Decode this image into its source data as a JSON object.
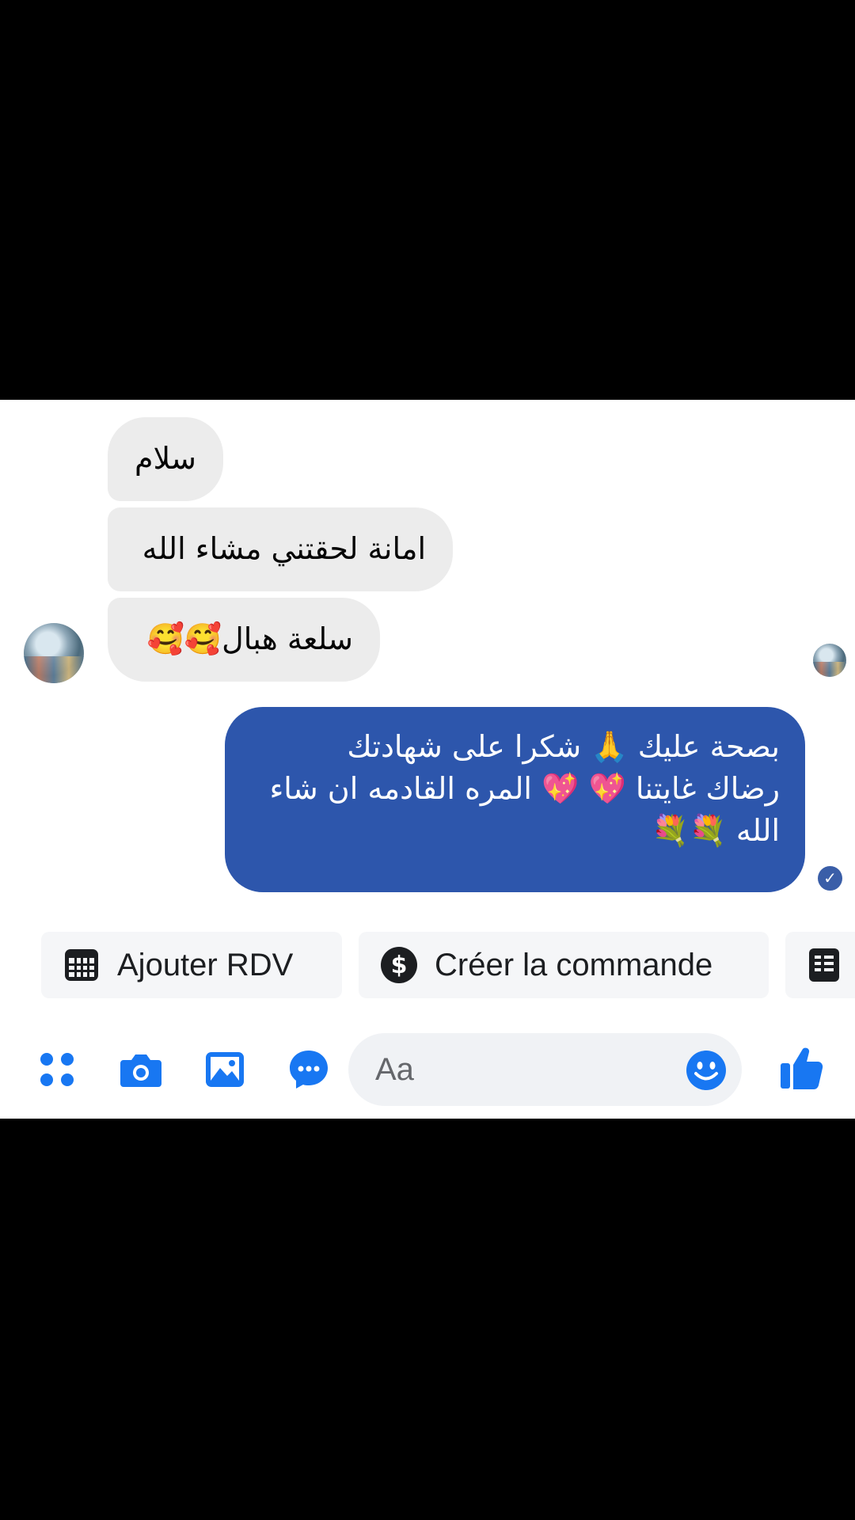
{
  "messages": {
    "incoming": [
      {
        "text": "سلام"
      },
      {
        "text": "امانة لحقتني مشاء الله"
      },
      {
        "text": "سلعة هبال🥰🥰"
      }
    ],
    "outgoing": {
      "lines": [
        "بصحة عليك 🙏 شكرا على شهادتك",
        "رضاك غايتنا 💖 💖 المره القادمه ان شاء",
        "الله 💐💐"
      ],
      "seen_icon": "check-circle-icon"
    }
  },
  "actions": {
    "add_appointment": {
      "label": "Ajouter RDV",
      "icon": "calendar-icon"
    },
    "create_order": {
      "label": "Créer la commande",
      "icon": "dollar-icon"
    },
    "more": {
      "icon": "receipt-icon"
    }
  },
  "composer": {
    "placeholder": "Aa",
    "tools": [
      "apps-icon",
      "camera-icon",
      "image-icon",
      "chat-bubble-icon"
    ],
    "emoji_icon": "smiley-icon",
    "send_icon": "thumbs-up-icon"
  },
  "colors": {
    "accent": "#1877f2",
    "outgoing_bubble": "#2d56ac",
    "incoming_bubble": "#ececec",
    "input_bg": "#f0f2f5"
  }
}
